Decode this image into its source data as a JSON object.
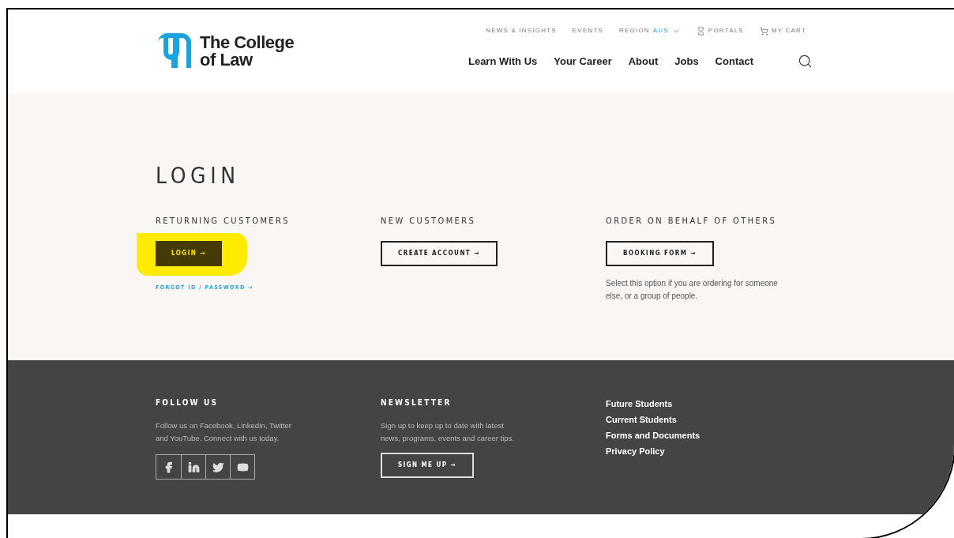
{
  "logo": {
    "line_1": "The College",
    "line_2": "of Law"
  },
  "utility_nav": [
    {
      "kind": "link",
      "label": "NEWS & INSIGHTS"
    },
    {
      "kind": "link",
      "label": "EVENTS"
    },
    {
      "kind": "region",
      "label": "REGION",
      "value": "AUS"
    },
    {
      "kind": "portals",
      "label": "PORTALS"
    },
    {
      "kind": "cart",
      "label": "MY CART"
    }
  ],
  "main_nav": [
    "Learn With Us",
    "Your Career",
    "About",
    "Jobs",
    "Contact"
  ],
  "page_title": "LOGIN",
  "sections": [
    {
      "heading": "RETURNING CUSTOMERS",
      "button": "LOGIN →",
      "highlighted": true,
      "filled": true,
      "link": "FORGOT ID / PASSWORD →"
    },
    {
      "heading": "NEW CUSTOMERS",
      "button": "CREATE ACCOUNT →",
      "highlighted": false,
      "filled": false
    },
    {
      "heading": "ORDER ON BEHALF OF OTHERS",
      "button": "BOOKING FORM →",
      "highlighted": false,
      "filled": false,
      "note": "Select this option if you are ordering for someone else, or a group of people."
    }
  ],
  "footer": {
    "follow": {
      "heading": "FOLLOW US",
      "text": "Follow us on Facebook, LinkedIn, Twitter and YouTube. Connect with us today."
    },
    "newsletter": {
      "heading": "NEWSLETTER",
      "text": "Sign up to keep up to date with latest news, programs, events and career tips.",
      "button": "SIGN ME UP →"
    },
    "links": [
      "Future Students",
      "Current Students",
      "Forms and Documents",
      "Privacy Policy"
    ]
  }
}
